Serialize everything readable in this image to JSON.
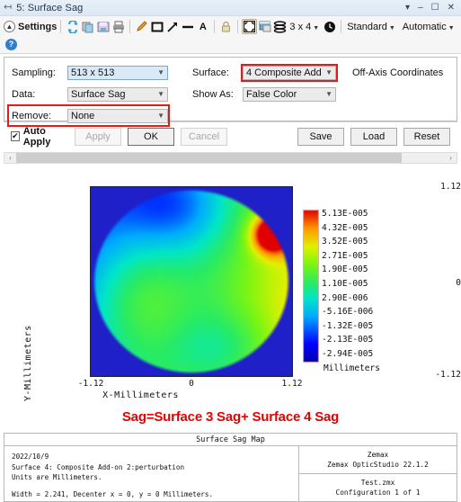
{
  "window": {
    "title": "5: Surface Sag",
    "pin_icon": "pin-icon",
    "controls": [
      "minimize-restore",
      "minimize",
      "maximize",
      "close"
    ],
    "control_glyphs": [
      "▾",
      "–",
      "☐",
      "✕"
    ]
  },
  "toolbar": {
    "settings_label": "Settings",
    "icons": [
      "refresh-icon",
      "copy-icon",
      "save-image-icon",
      "print-icon",
      "pencil-icon",
      "rectangle-icon",
      "arrow-icon",
      "line-icon",
      "text-icon",
      "lock-icon",
      "fit-window-icon",
      "window-icon",
      "layers-icon"
    ],
    "grid_label": "3 x 4",
    "clock_icon": "clock-icon",
    "style_dropdown": "Standard",
    "scale_dropdown": "Automatic",
    "help_icon": "help-icon",
    "help_glyph": "?"
  },
  "settings": {
    "sampling_label": "Sampling:",
    "sampling_value": "513 x 513",
    "data_label": "Data:",
    "data_value": "Surface Sag",
    "remove_label": "Remove:",
    "remove_value": "None",
    "surface_label": "Surface:",
    "surface_value": "4 Composite Add",
    "show_as_label": "Show As:",
    "show_as_value": "False Color",
    "off_axis_label": "Off-Axis Coordinates",
    "highlight_color": "#e81919"
  },
  "buttons": {
    "auto_apply_label": "Auto Apply",
    "auto_apply_checked": true,
    "check_glyph": "✔",
    "apply": "Apply",
    "ok": "OK",
    "cancel": "Cancel",
    "save": "Save",
    "load": "Load",
    "reset": "Reset"
  },
  "scrollbar": {
    "left_arrow": "‹",
    "right_arrow": "›"
  },
  "annotation": {
    "text": "Sag=Surface 3 Sag+ Surface 4 Sag",
    "color": "#e60000"
  },
  "footer": {
    "title": "Surface Sag Map",
    "lines": [
      "2022/10/9",
      "Surface 4: Composite Add-on 2:perturbation",
      "Units are Millimeters."
    ],
    "width_line": "Width = 2.241, Decenter x = 0, y = 0 Millimeters.",
    "vendor": "Zemax",
    "product": "Zemax OpticStudio 22.1.2",
    "file": "Test.zmx",
    "configuration": "Configuration 1 of 1"
  },
  "chart_data": {
    "type": "heatmap",
    "title": "Surface Sag Map",
    "xlabel": "X-Millimeters",
    "ylabel": "Y-Millimeters",
    "xticks": [
      "-1.12",
      "0",
      "1.12"
    ],
    "yticks": [
      "1.12",
      "0",
      "-1.12"
    ],
    "xlim": [
      -1.12,
      1.12
    ],
    "ylim": [
      -1.12,
      1.12
    ],
    "colorbar_units": "Millimeters",
    "colorbar_labels": [
      "5.13E-005",
      "4.32E-005",
      "3.52E-005",
      "2.71E-005",
      "1.90E-005",
      "1.10E-005",
      "2.90E-006",
      "-5.16E-006",
      "-1.32E-005",
      "-2.13E-005",
      "-2.94E-005"
    ],
    "zmin": -2.94e-05,
    "zmax": 5.13e-05,
    "colormap": "jet",
    "background_color": "#2020c8",
    "aperture": "circular",
    "aperture_radius_mm": 1.12,
    "description": "Circular pupil sag map: green/yellow-green dominant on the left and center-left, cyan-blue in the upper-left and lower-right arcs, with a sharp red maximum near the upper-right rim.",
    "grid": false
  }
}
